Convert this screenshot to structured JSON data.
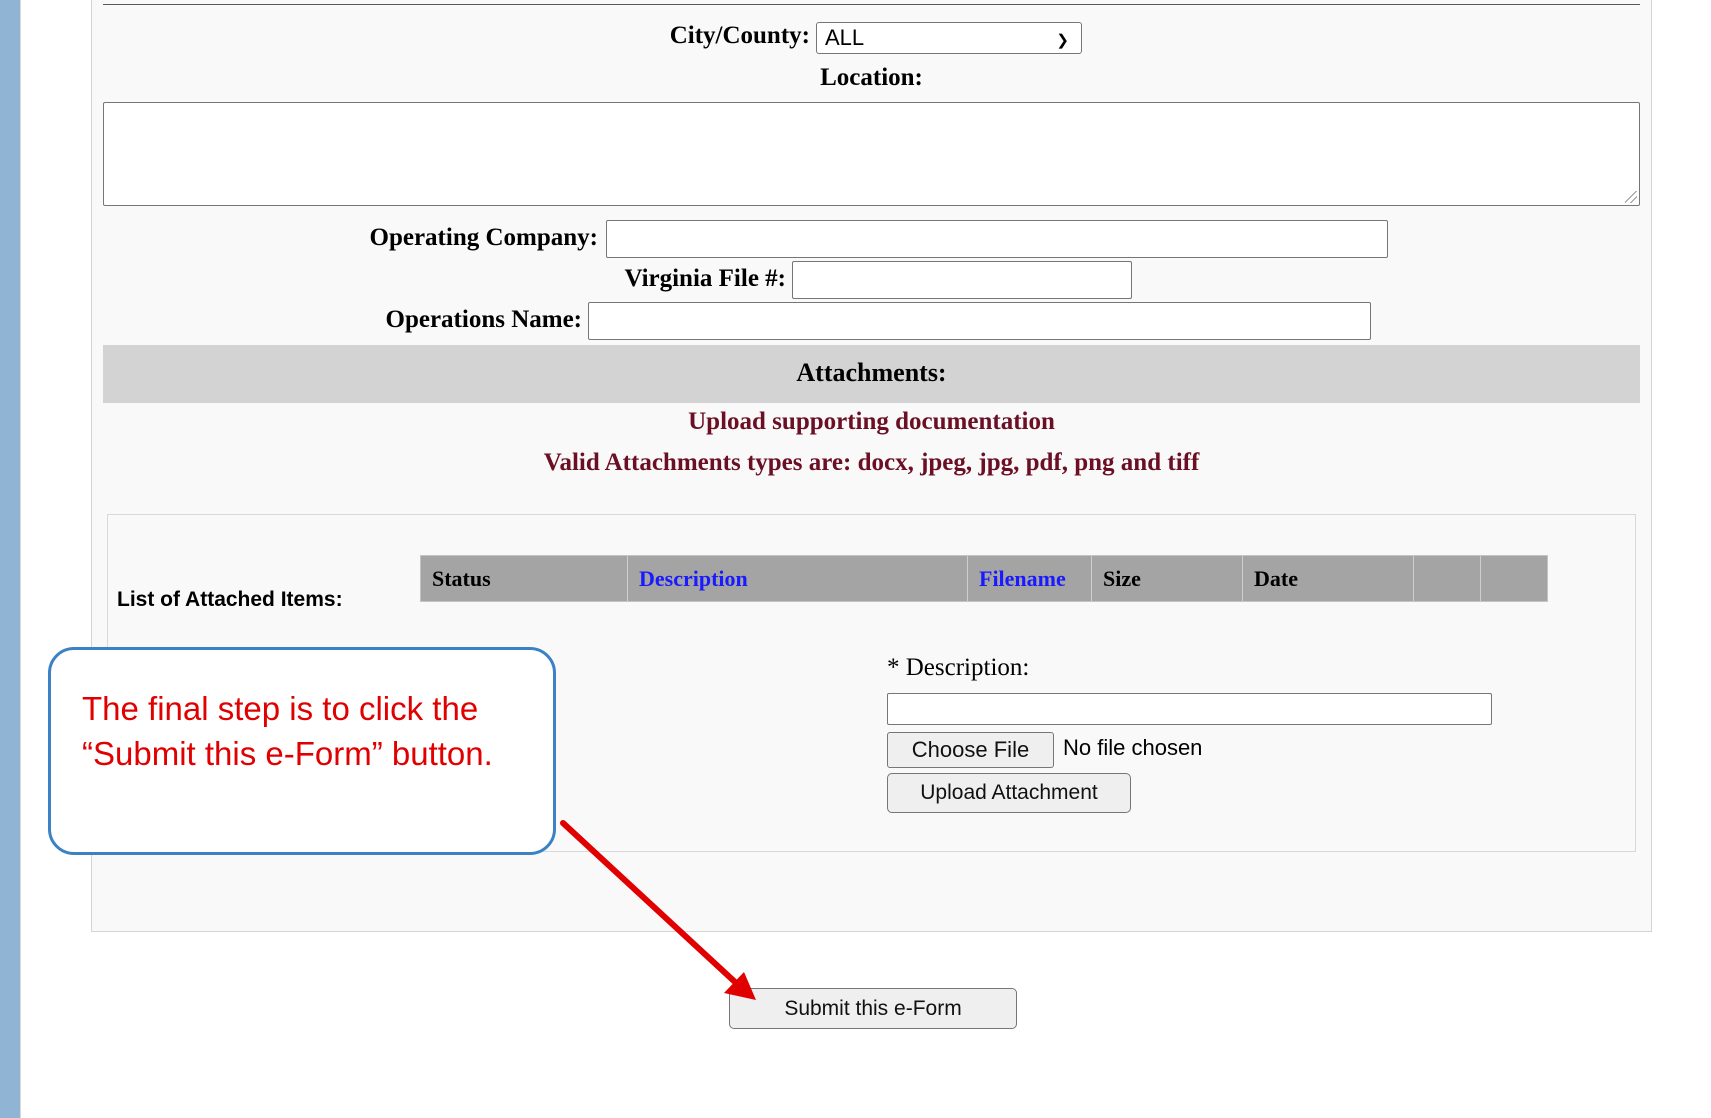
{
  "form": {
    "city_county_label": "City/County:",
    "city_county_value": "ALL",
    "location_label": "Location:",
    "operating_company_label": "Operating Company:",
    "virginia_file_label": "Virginia File #:",
    "operations_name_label": "Operations Name:"
  },
  "attachments": {
    "heading": "Attachments:",
    "instruction": "Upload supporting documentation",
    "valid_types": "Valid Attachments types are: docx, jpeg, jpg, pdf, png and tiff",
    "list_label": "List of Attached Items:",
    "columns": [
      "Status",
      "Description",
      "Filename",
      "Size",
      "Date",
      "",
      ""
    ],
    "description_label": "* Description:",
    "choose_file_label": "Choose File",
    "no_file_text": "No file chosen",
    "upload_button": "Upload Attachment"
  },
  "submit_button": "Submit this e-Form",
  "callout": {
    "text": "The final step is to click the “Submit this e-Form” button."
  },
  "colors": {
    "callout_border": "#3b82c4",
    "callout_text": "#e00000",
    "arrow": "#e00000",
    "link_header": "#1a1aff",
    "instruction_text": "#6b0f24"
  }
}
